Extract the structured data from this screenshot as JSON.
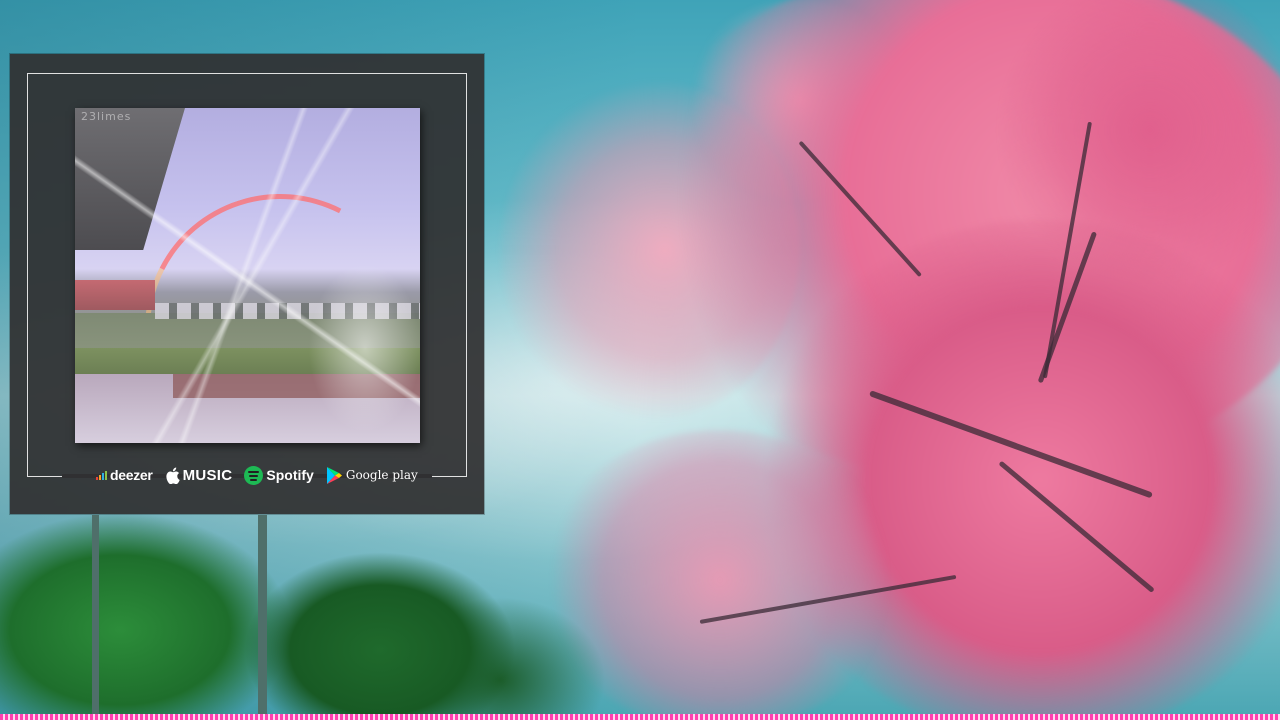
{
  "background": {
    "description_colors": {
      "sky": "#6dc2cf",
      "blossom": "#e86e97",
      "foliage": "#2c8d3a",
      "progress_strip": "#ff3fb0"
    }
  },
  "player": {
    "artwork": {
      "tag": "23limes"
    },
    "streaming": [
      {
        "name": "deezer",
        "label": "deezer",
        "icon": "deezer-bars-icon"
      },
      {
        "name": "apple-music",
        "label": "MUSIC",
        "icon": "apple-icon"
      },
      {
        "name": "spotify",
        "label": "Spotify",
        "icon": "spotify-icon"
      },
      {
        "name": "google-play",
        "label": "Google play",
        "icon": "google-play-icon"
      }
    ]
  }
}
